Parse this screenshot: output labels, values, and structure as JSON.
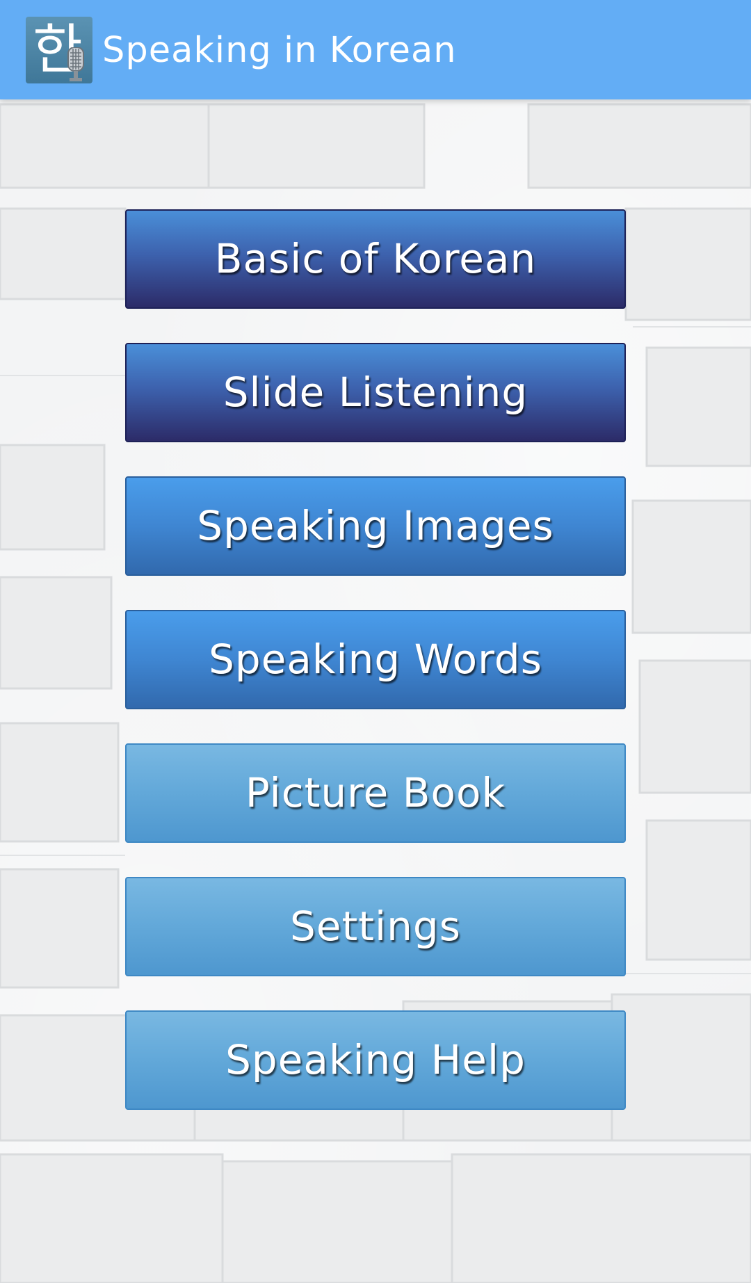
{
  "app_bar": {
    "icon_glyph": "한",
    "icon_name": "korean-microphone-app-icon",
    "title": "Speaking in Korean",
    "background_color": "#63adf5"
  },
  "menu": {
    "items": [
      {
        "label": "Basic of Korean",
        "style": "dark"
      },
      {
        "label": "Slide Listening",
        "style": "dark"
      },
      {
        "label": "Speaking Images",
        "style": "mid"
      },
      {
        "label": "Speaking Words",
        "style": "mid"
      },
      {
        "label": "Picture Book",
        "style": "light"
      },
      {
        "label": "Settings",
        "style": "light"
      },
      {
        "label": "Speaking Help",
        "style": "light"
      }
    ]
  },
  "colors": {
    "dark_button_top": "#4a8fd8",
    "dark_button_bottom": "#2c2b68",
    "mid_button_top": "#4a9deb",
    "mid_button_bottom": "#3169ad",
    "light_button_top": "#79b8e2",
    "light_button_bottom": "#4e97cf",
    "wall": "#f3f4f5"
  }
}
